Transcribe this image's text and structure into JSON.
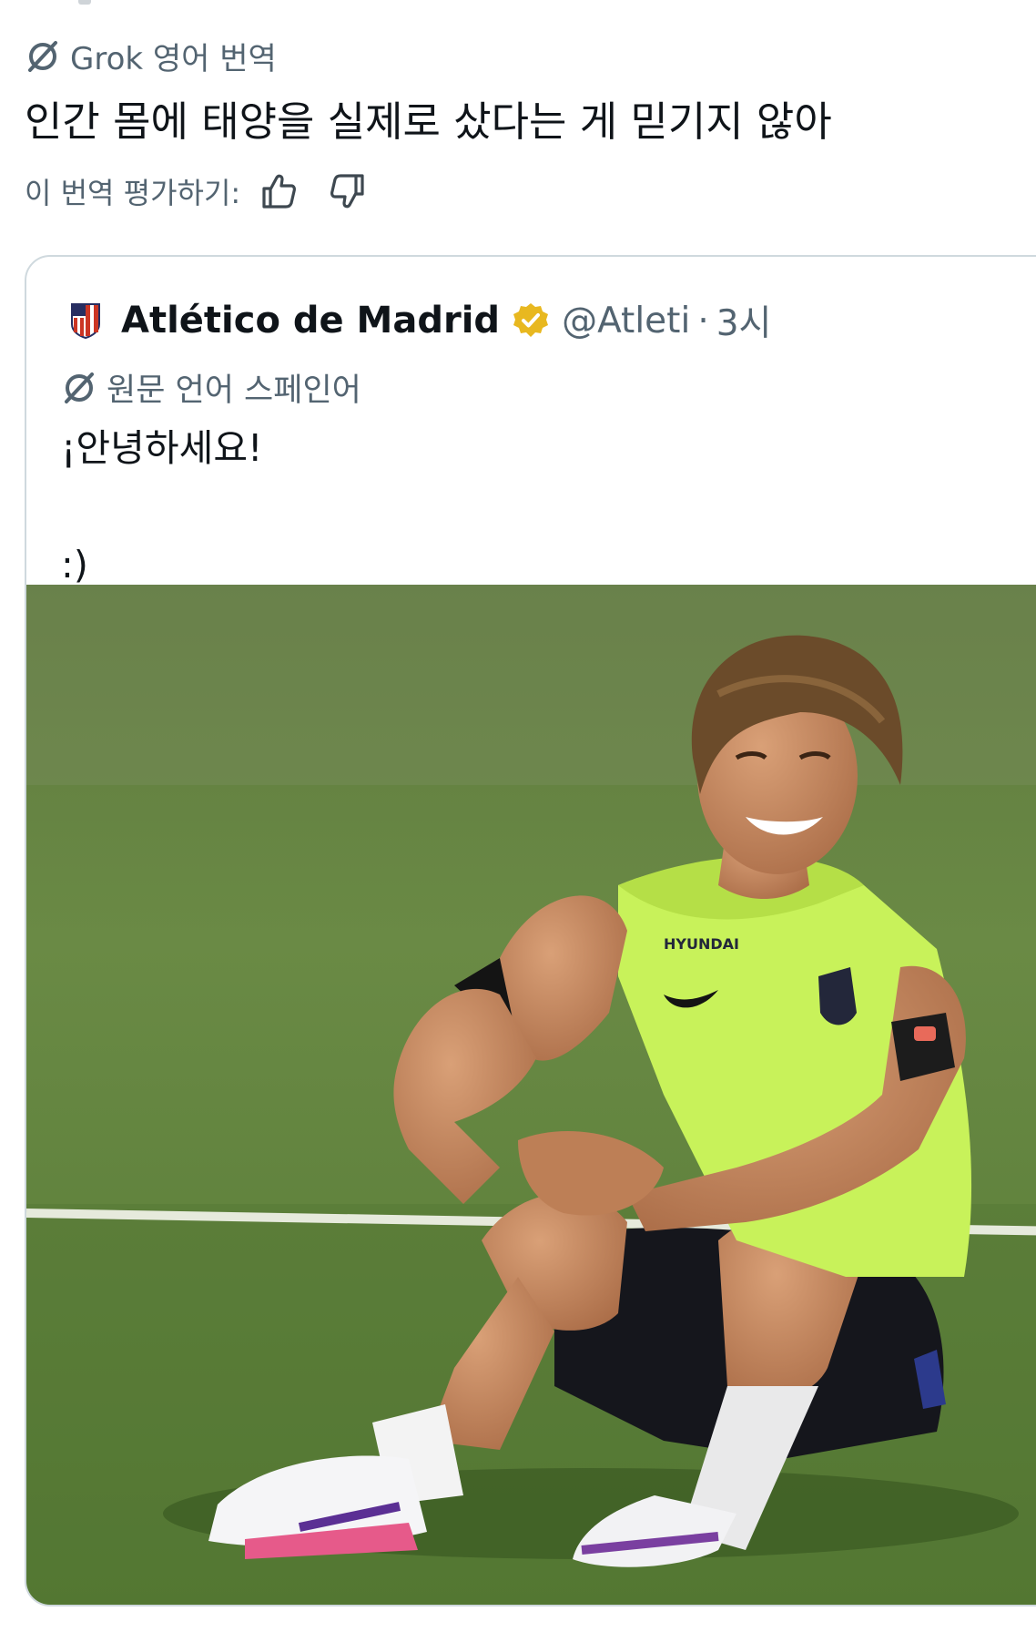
{
  "translation": {
    "provider_label": "Grok 영어 번역",
    "text": "인간 몸에 태양을 실제로 샀다는 게 믿기지 않아",
    "rate_label": "이 번역 평가하기:",
    "icons": {
      "grok": "grok-icon",
      "like": "thumbs-up-icon",
      "dislike": "thumbs-down-icon"
    }
  },
  "quote": {
    "account_name": "Atlético de Madrid",
    "handle": "@Atleti",
    "separator": "·",
    "time": "3시",
    "original_language": "원문 언어 스페인어",
    "text": "¡안녕하세요!\n\n:)",
    "icons": {
      "avatar": "atletico-crest-icon",
      "verified": "verified-badge-icon",
      "language": "grok-icon"
    },
    "colors": {
      "verified": "#e8b820",
      "crest_red": "#cb3524",
      "crest_blue": "#272e61"
    }
  },
  "colors": {
    "text": "#0f1419",
    "secondary": "#536471",
    "border": "#cfd9de"
  }
}
